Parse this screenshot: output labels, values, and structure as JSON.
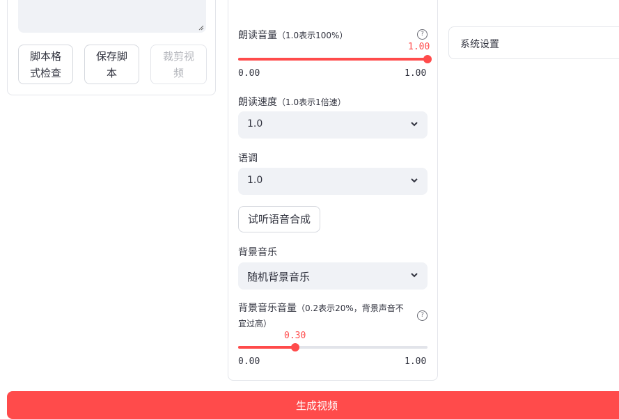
{
  "left": {
    "buttons": [
      {
        "label": "脚本格\n式检查",
        "enabled": true
      },
      {
        "label": "保存脚\n本",
        "enabled": true
      },
      {
        "label": "裁剪视\n频",
        "enabled": false
      }
    ]
  },
  "voice": {
    "volume": {
      "label": "朗读音量",
      "hint": "（1.0表示100%）",
      "value": "1.00",
      "min": "0.00",
      "max": "1.00",
      "fraction": 1.0
    },
    "speed": {
      "label": "朗读速度",
      "hint": "（1.0表示1倍速）",
      "selected": "1.0"
    },
    "pitch": {
      "label": "语调",
      "selected": "1.0"
    },
    "preview_button": "试听语音合成"
  },
  "bgm": {
    "label": "背景音乐",
    "selected": "随机背景音乐",
    "volume": {
      "label": "背景音乐音量",
      "hint_line1": "（0.2表示20%，背景声音不",
      "hint_line2": "宜过高）",
      "value": "0.30",
      "min": "0.00",
      "max": "1.00",
      "fraction": 0.3
    }
  },
  "settings": {
    "label": "系统设置"
  },
  "generate_button": "生成视频",
  "colors": {
    "accent": "#ff4b4b",
    "input_bg": "#f0f2f6",
    "border": "#e3e5ea",
    "text": "#31333f"
  },
  "icons": [
    "resize-handle-icon",
    "help-icon",
    "chevron-down-icon"
  ]
}
